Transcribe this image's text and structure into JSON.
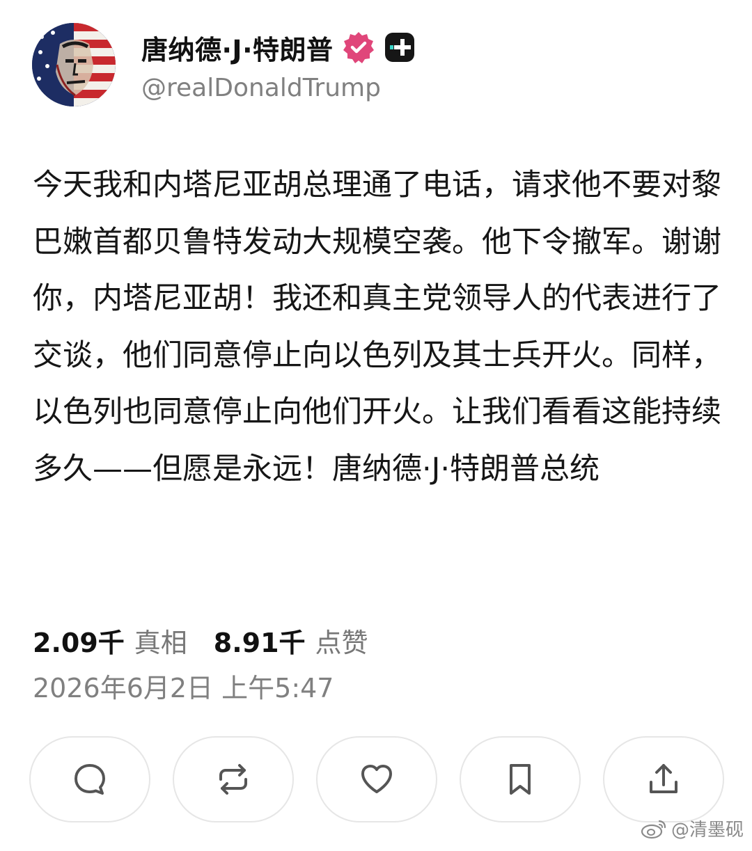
{
  "author": {
    "display_name": "唐纳德·J·特朗普",
    "handle": "@realDonaldTrump",
    "avatar_icon": "flag-portrait-avatar",
    "verified_icon": "verified-badge-icon",
    "extra_badge_icon": "plus-badge-icon"
  },
  "post": {
    "text": "今天我和内塔尼亚胡总理通了电话，请求他不要对黎巴嫩首都贝鲁特发动大规模空袭。他下令撤军。谢谢你，内塔尼亚胡！我还和真主党领导人的代表进行了交谈，他们同意停止向以色列及其士兵开火。同样，以色列也同意停止向他们开火。让我们看看这能持续多久——但愿是永远！唐纳德·J·特朗普总统"
  },
  "stats": {
    "retruths_count": "2.09千",
    "retruths_label": "真相",
    "likes_count": "8.91千",
    "likes_label": "点赞"
  },
  "timestamp": "2026年6月2日 上午5:47",
  "actions": [
    {
      "name": "reply",
      "icon": "comment-icon"
    },
    {
      "name": "repost",
      "icon": "repost-icon"
    },
    {
      "name": "like",
      "icon": "heart-icon"
    },
    {
      "name": "bookmark",
      "icon": "bookmark-icon"
    },
    {
      "name": "share",
      "icon": "share-icon"
    }
  ],
  "watermark": {
    "text": "@清墨砚",
    "icon": "weibo-logo-icon"
  },
  "colors": {
    "verified_badge": "#e0467a",
    "secondary_text": "#808080",
    "button_border": "#e6e6e6",
    "icon_gray": "#555555"
  }
}
